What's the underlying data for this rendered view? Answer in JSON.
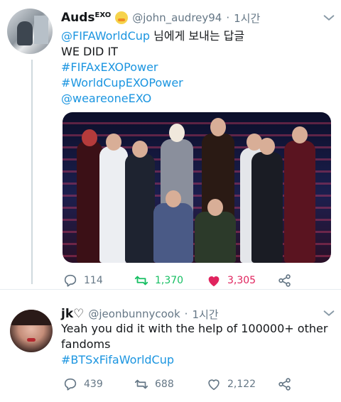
{
  "tweets": [
    {
      "author_name": "Auds",
      "author_super": "EXO",
      "badge_emoji": "chick-emoji",
      "handle": "@john_audrey94",
      "separator": "·",
      "time": "1시간",
      "reply_to_handle": "@FIFAWorldCup",
      "reply_to_text": " 님에게 보내는 답글",
      "text": "WE DID IT",
      "hashtags": [
        "#FIFAxEXOPower",
        "#WorldCupEXOPower"
      ],
      "mention": "@weareoneEXO",
      "replies": "114",
      "retweets": "1,370",
      "likes": "3,305",
      "retweeted": true,
      "liked": true
    },
    {
      "author_name": "jk♡",
      "handle": "@jeonbunnycook",
      "separator": "·",
      "time": "1시간",
      "text": "Yeah you did it with the help of 100000+ other fandoms",
      "hashtag": "#BTSxFifaWorldCup",
      "replies": "439",
      "retweets": "688",
      "likes": "2,122",
      "retweeted": false,
      "liked": false
    }
  ],
  "colors": {
    "link": "#1b95e0",
    "muted": "#657786",
    "retweet_active": "#17bf63",
    "like_active": "#e0245e"
  },
  "icons": [
    "chevron-down-icon",
    "reply-icon",
    "retweet-icon",
    "like-icon",
    "share-icon"
  ]
}
